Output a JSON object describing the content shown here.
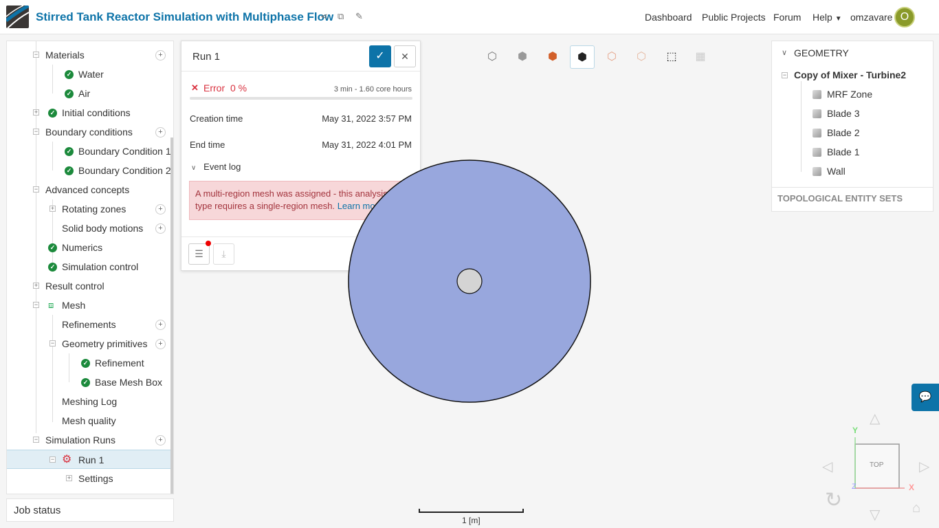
{
  "header": {
    "title": "Stirred Tank Reactor Simulation with Multiphase Flow",
    "nav": [
      "Dashboard",
      "Public Projects",
      "Forum",
      "Help"
    ],
    "username": "omzavare",
    "avatar_initial": "O"
  },
  "tree": {
    "items": [
      {
        "label": "Materials"
      },
      {
        "label": "Water"
      },
      {
        "label": "Air"
      },
      {
        "label": "Initial conditions"
      },
      {
        "label": "Boundary conditions"
      },
      {
        "label": "Boundary Condition 1"
      },
      {
        "label": "Boundary Condition 2"
      },
      {
        "label": "Advanced concepts"
      },
      {
        "label": "Rotating zones"
      },
      {
        "label": "Solid body motions"
      },
      {
        "label": "Numerics"
      },
      {
        "label": "Simulation control"
      },
      {
        "label": "Result control"
      },
      {
        "label": "Mesh"
      },
      {
        "label": "Refinements"
      },
      {
        "label": "Geometry primitives"
      },
      {
        "label": "Refinement"
      },
      {
        "label": "Base Mesh Box"
      },
      {
        "label": "Meshing Log"
      },
      {
        "label": "Mesh quality"
      },
      {
        "label": "Simulation Runs"
      },
      {
        "label": "Run 1"
      },
      {
        "label": "Settings"
      }
    ]
  },
  "job_status": "Job status",
  "run_panel": {
    "title": "Run 1",
    "status": "Error",
    "progress_label": "0 %",
    "progress": 0,
    "usage": "3 min - 1.60 core hours",
    "creation_label": "Creation time",
    "creation_value": "May 31, 2022 3:57 PM",
    "end_label": "End time",
    "end_value": "May 31, 2022 4:01 PM",
    "event_log_label": "Event log",
    "error_message": "A multi-region mesh was assigned - this analysis-type requires a single-region mesh.",
    "learn_more": "Learn more"
  },
  "geometry": {
    "title": "GEOMETRY",
    "root": "Copy of Mixer - Turbine2",
    "items": [
      "MRF Zone",
      "Blade 3",
      "Blade 2",
      "Blade 1",
      "Wall"
    ],
    "topo": "TOPOLOGICAL ENTITY SETS"
  },
  "viewport": {
    "scale_label": "1 [m]",
    "view_label": "TOP",
    "axis_x": "X",
    "axis_y": "Y",
    "axis_z": "Z"
  },
  "colors": {
    "brand": "#0d73a8",
    "error": "#d9303e",
    "success": "#1c8a3c",
    "domain": "#98a7dd"
  }
}
